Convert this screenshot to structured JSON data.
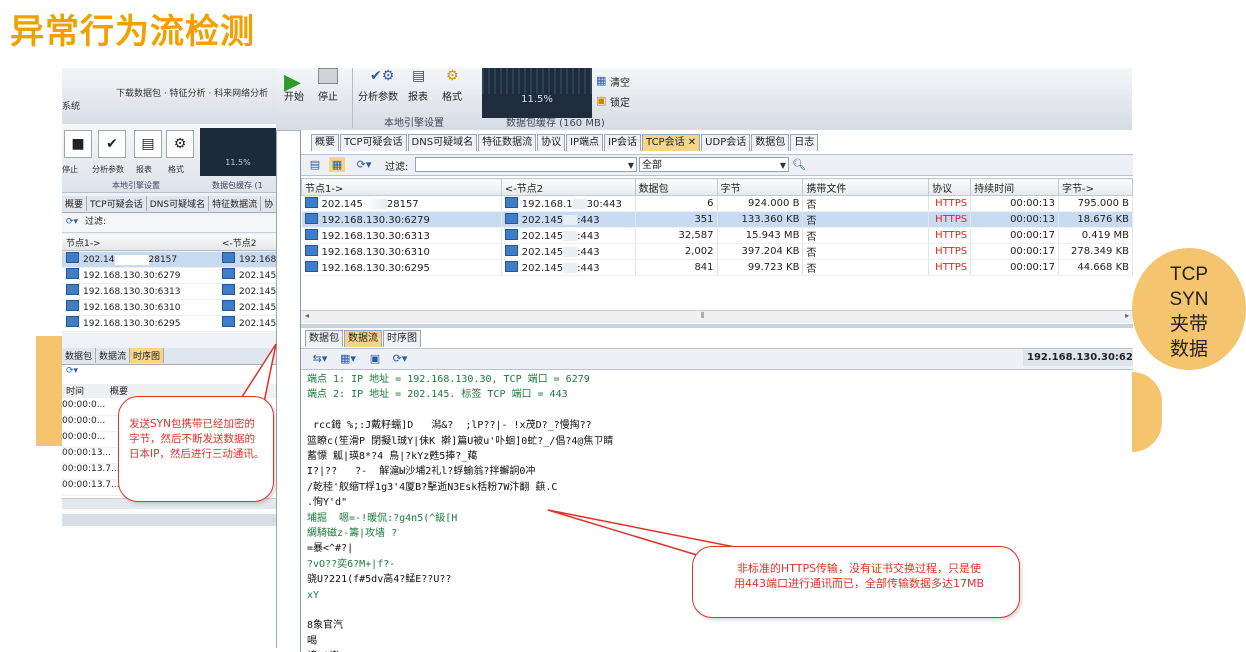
{
  "slide_title": "异常行为流检测",
  "bg_window": {
    "status_text": "下载数据包 · 特征分析 · 科来网络分析系统",
    "ribbon_labels": [
      "停止",
      "分析参数",
      "报表",
      "格式"
    ],
    "group_label": "本地引擎设置",
    "buffer_label": "数据包缓存 (1",
    "graph_value": "11.5%",
    "tabs": [
      "概要",
      "TCP可疑会话",
      "DNS可疑域名",
      "特征数据流",
      "协"
    ],
    "filter_label": "过滤:",
    "col_headers": [
      "节点1->",
      "<-节点2"
    ],
    "rows": [
      {
        "n1": "202.14",
        "n1b": "28157",
        "n2": "192.168"
      },
      {
        "n1": "192.168.130.30:6279",
        "n1b": "",
        "n2": "202.145"
      },
      {
        "n1": "192.168.130.30:6313",
        "n1b": "",
        "n2": "202.145."
      },
      {
        "n1": "192.168.130.30:6310",
        "n1b": "",
        "n2": "202.145."
      },
      {
        "n1": "192.168.130.30:6295",
        "n1b": "",
        "n2": "202.145."
      }
    ],
    "subtabs": [
      "数据包",
      "数据流",
      "时序图"
    ],
    "sub_header": [
      "时间",
      "概要"
    ],
    "sub_rows": [
      "00:00:0...",
      "00:00:0...",
      "00:00:0...",
      "00:00:13...",
      "00:00:13.7...",
      "00:00:13.7..."
    ]
  },
  "fg_ribbon": {
    "start": "开始",
    "stop": "停止",
    "analysis_params": "分析参数",
    "report": "报表",
    "format": "格式",
    "group": "本地引擎设置",
    "buffer": "数据包缓存 (160 MB)",
    "graph_value": "11.5%",
    "clear": "清空",
    "lock": "锁定"
  },
  "tabs": [
    "概要",
    "TCP可疑会话",
    "DNS可疑域名",
    "特征数据流",
    "协议",
    "IP端点",
    "IP会话",
    "TCP会话",
    "UDP会话",
    "数据包",
    "日志"
  ],
  "active_tab": "TCP会话",
  "toolbar": {
    "filter_label": "过滤:",
    "filter_value": "",
    "scope_value": "全部"
  },
  "columns": [
    "节点1->",
    "<-节点2",
    "数据包",
    "字节",
    "携带文件",
    "协议",
    "持续时间",
    "字节->"
  ],
  "rows": [
    {
      "node1": "202.145",
      "node1_tail": "28157",
      "node2": "192.168.1",
      "node2_tail": "30:443",
      "packets": "6",
      "bytes": "924.000 B",
      "file": "否",
      "proto": "HTTPS",
      "duration": "00:00:13",
      "bytes_out": "795.000 B",
      "selected": false
    },
    {
      "node1": "192.168.130.30:6279",
      "node1_tail": "",
      "node2": "202.145",
      "node2_tail": ":443",
      "packets": "351",
      "bytes": "133.360 KB",
      "file": "否",
      "proto": "HTTPS",
      "duration": "00:00:13",
      "bytes_out": "18.676 KB",
      "selected": true
    },
    {
      "node1": "192.168.130.30:6313",
      "node1_tail": "",
      "node2": "202.145",
      "node2_tail": ":443",
      "packets": "32,587",
      "bytes": "15.943 MB",
      "file": "否",
      "proto": "HTTPS",
      "duration": "00:00:17",
      "bytes_out": "0.419 MB",
      "selected": false
    },
    {
      "node1": "192.168.130.30:6310",
      "node1_tail": "",
      "node2": "202.145",
      "node2_tail": ":443",
      "packets": "2,002",
      "bytes": "397.204 KB",
      "file": "否",
      "proto": "HTTPS",
      "duration": "00:00:17",
      "bytes_out": "278.349 KB",
      "selected": false
    },
    {
      "node1": "192.168.130.30:6295",
      "node1_tail": "",
      "node2": "202.145",
      "node2_tail": ":443",
      "packets": "841",
      "bytes": "99.723 KB",
      "file": "否",
      "proto": "HTTPS",
      "duration": "00:00:17",
      "bytes_out": "44.668 KB",
      "selected": false
    }
  ],
  "panel_tabs": [
    "数据包",
    "数据流",
    "时序图"
  ],
  "active_panel_tab": "数据流",
  "panel_address": "192.168.130.30:6279",
  "stream_lines": [
    {
      "text": "端点 1: IP 地址 = 192.168.130.30, TCP 端口 = 6279",
      "green": true
    },
    {
      "text": "端点 2: IP 地址 = 202.145. 标签 TCP 端口 = 443",
      "green": true
    },
    {
      "text": "",
      "green": false
    },
    {
      "text": " rcc鉧 %;:J戴籽蠕]D   潟&?  ;lP??|- !x茂D?_?慢掏??",
      "green": false
    },
    {
      "text": "篮瞭c(笙滑P 閉擬l珹Y|佅K 擀]篇U被u'卟蛔]0虻?_/倡?4@焦ㄗ睛",
      "green": false
    },
    {
      "text": "蓄慓 觚|瑛8*?4 鳥|?kYz甦5捧?_藒",
      "green": false
    },
    {
      "text": "I?|??   ?-  解滬Ы沙埔2礼l?蜉蝓翁?拌蠏詗0冲",
      "green": false
    },
    {
      "text": "/乾稑'舣缩T桴1g3'4厦B?擊逝N3Esk栝粉7W汴翻 蕻.C",
      "green": false
    },
    {
      "text": ".恂Y'd\"",
      "green": false
    },
    {
      "text": "埔掘  嗯=-!暖侃:?g4n5(^級[H",
      "green": true
    },
    {
      "text": "綢騎磁z-籌|攻墙 ?",
      "green": true
    },
    {
      "text": "=暴<^#?|",
      "green": false
    },
    {
      "text": "?vO??奕6?M+|f?-",
      "green": true
    },
    {
      "text": "骁U?221(f#5dv高4?鯭E??U??",
      "green": false
    },
    {
      "text": "xY",
      "green": true
    },
    {
      "text": "",
      "green": false
    },
    {
      "text": "8象官汽",
      "green": false
    },
    {
      "text": "喝",
      "green": false
    },
    {
      "text": "謗?|蟛?,;?",
      "green": false
    }
  ],
  "callouts": {
    "syn": "发送SYN包携带已经加密的\n字节，然后不断发送数据的\n日本IP，然后进行三动通讯。",
    "https": "非标准的HTTPS传输，没有证书交换过程，只是使\n用443端口进行通讯而已，全部传输数据多达17MB",
    "bubble_lines": [
      "TCP",
      "SYN",
      "夹带",
      "数据"
    ]
  },
  "colors": {
    "title": "#f0a000",
    "bubble": "#f5c46e",
    "callout": "#e0312a",
    "https": "#e2231a",
    "selected_row": "#c9dbf3",
    "active_tab": "#f6d58a"
  }
}
